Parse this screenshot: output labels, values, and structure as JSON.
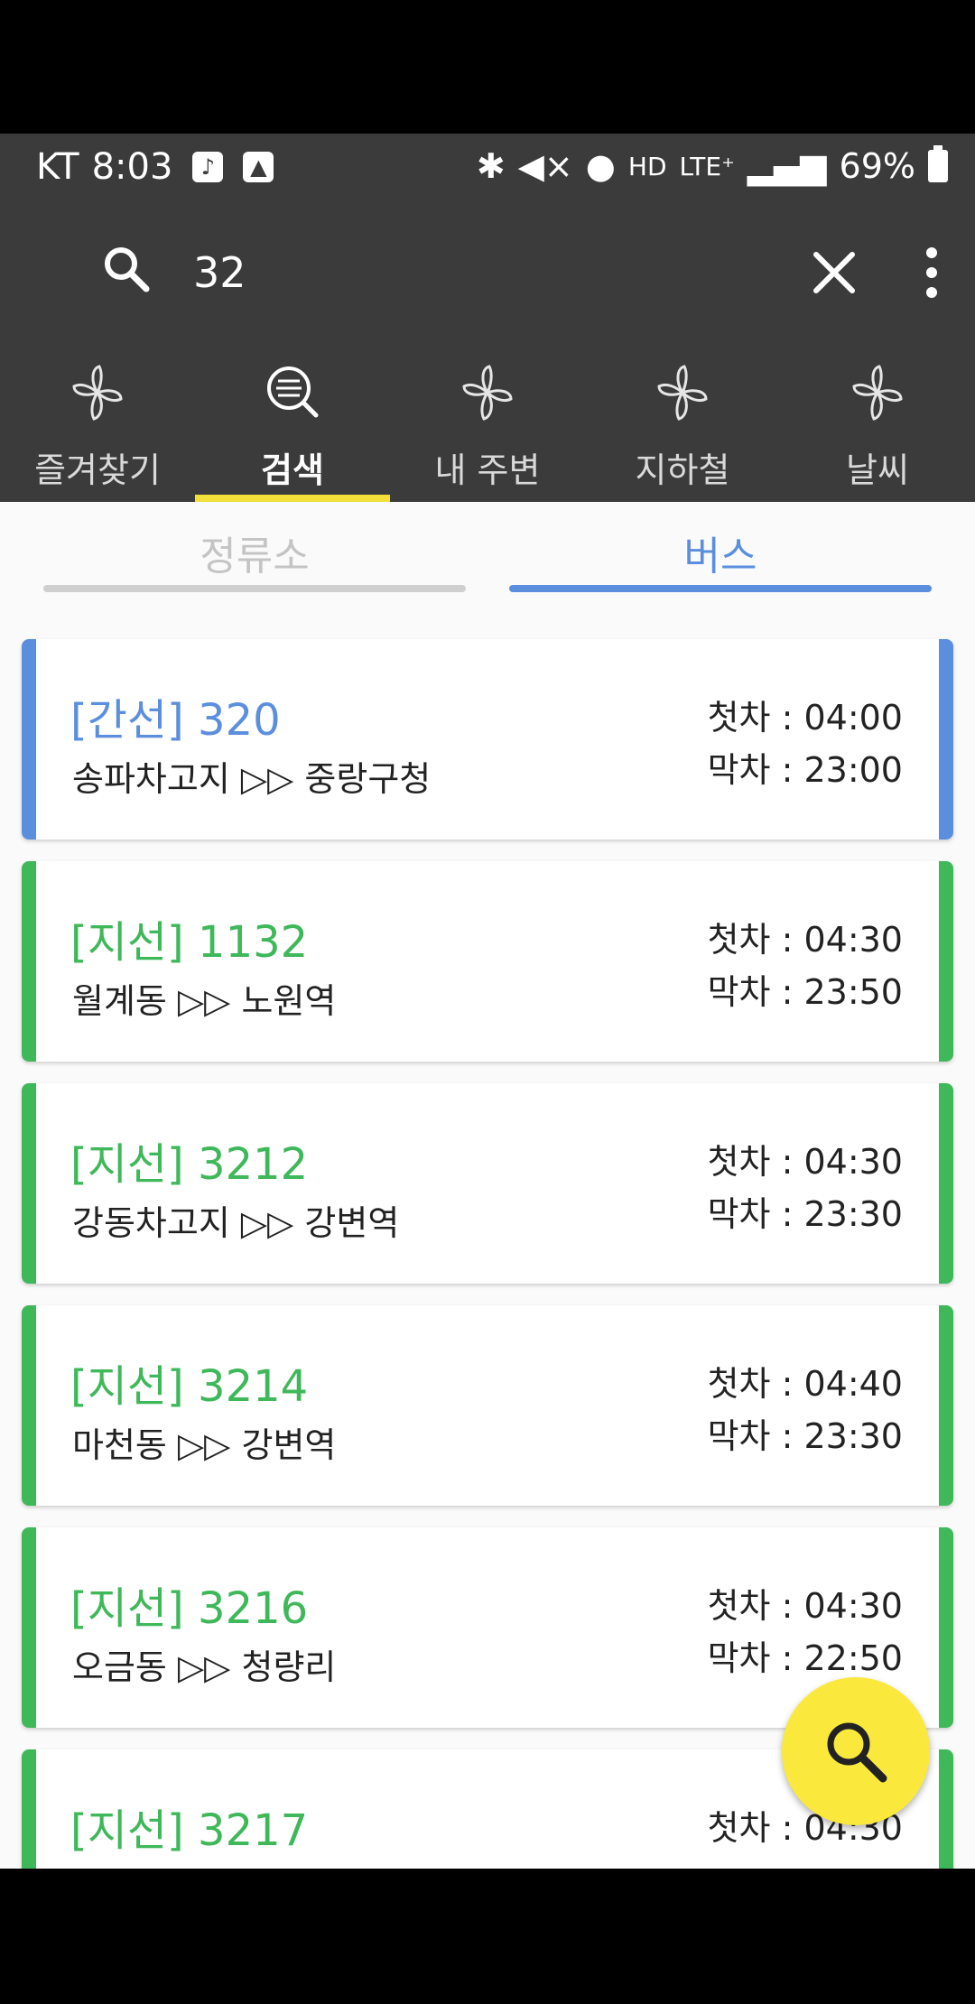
{
  "status_bar": {
    "carrier": "KT",
    "time": "8:03",
    "lte_label": "LTE⁺",
    "battery": "69%"
  },
  "search": {
    "query": "32"
  },
  "category_tabs": [
    {
      "label": "즐겨찾기",
      "icon": "pinwheel-icon",
      "active": false
    },
    {
      "label": "검색",
      "icon": "search-list-icon",
      "active": true
    },
    {
      "label": "내 주변",
      "icon": "pinwheel-icon",
      "active": false
    },
    {
      "label": "지하철",
      "icon": "pinwheel-icon",
      "active": false
    },
    {
      "label": "날씨",
      "icon": "pinwheel-icon",
      "active": false
    }
  ],
  "sub_tabs": {
    "stop": "정류소",
    "bus": "버스",
    "active": "bus"
  },
  "routes": [
    {
      "title": "[간선] 320",
      "route": "송파차고지 ▷▷ 중랑구청",
      "first": "첫차 : 04:00",
      "last": "막차 : 23:00",
      "color": "#5b8fde"
    },
    {
      "title": "[지선] 1132",
      "route": "월계동 ▷▷ 노원역",
      "first": "첫차 : 04:30",
      "last": "막차 : 23:50",
      "color": "#3fb85a"
    },
    {
      "title": "[지선] 3212",
      "route": "강동차고지 ▷▷ 강변역",
      "first": "첫차 : 04:30",
      "last": "막차 : 23:30",
      "color": "#3fb85a"
    },
    {
      "title": "[지선] 3214",
      "route": "마천동 ▷▷ 강변역",
      "first": "첫차 : 04:40",
      "last": "막차 : 23:30",
      "color": "#3fb85a"
    },
    {
      "title": "[지선] 3216",
      "route": "오금동 ▷▷ 청량리",
      "first": "첫차 : 04:30",
      "last": "막차 : 22:50",
      "color": "#3fb85a"
    },
    {
      "title": "[지선] 3217",
      "route": "",
      "first": "첫차 : 04:30",
      "last": "",
      "color": "#3fb85a"
    }
  ],
  "colors": {
    "header_bg": "#3b3b3b",
    "accent_blue": "#5b8fde",
    "branch_green": "#3fb85a",
    "tab_indicator": "#f2df3a",
    "fab": "#fbe83c"
  }
}
